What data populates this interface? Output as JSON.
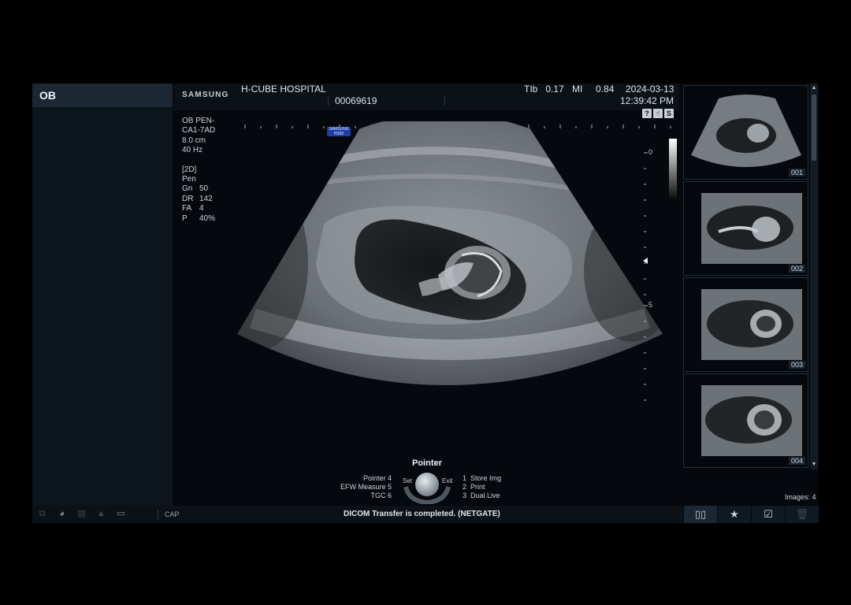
{
  "mode": {
    "title": "OB"
  },
  "header": {
    "brand": "SAMSUNG",
    "hospital": "H-CUBE HOSPITAL",
    "patient_id": "00069619",
    "tib_label": "TIb",
    "tib_value": "0.17",
    "mi_label": "MI",
    "mi_value": "0.84",
    "date": "2024-03-13",
    "time": "12:39:42 PM"
  },
  "status_icons": [
    "?",
    "☝",
    "S"
  ],
  "params": {
    "preset": "OB PEN-",
    "probe": "CA1-7AD",
    "depth": "8.0 cm",
    "frame_rate": "40 Hz",
    "mode": "[2D]",
    "pen": "Pen",
    "rows": [
      {
        "label": "Gn",
        "value": "50"
      },
      {
        "label": "DR",
        "value": "142"
      },
      {
        "label": "FA",
        "value": "4"
      },
      {
        "label": "P",
        "value": "40%"
      }
    ]
  },
  "probe_badge": {
    "line1": "SAMSUNG",
    "line2": "HS50"
  },
  "depth_scale": {
    "labels": [
      "0",
      "5"
    ]
  },
  "thumbnails": [
    {
      "id": "001"
    },
    {
      "id": "002"
    },
    {
      "id": "003"
    },
    {
      "id": "004"
    }
  ],
  "pointer_menu": {
    "title": "Pointer",
    "left": [
      {
        "label": "Pointer",
        "key": "4"
      },
      {
        "label": "EFW Measure",
        "key": "5"
      },
      {
        "label": "TGC",
        "key": "6"
      }
    ],
    "set_label": "Set",
    "exit_label": "Exit",
    "right": [
      {
        "key": "1",
        "label": "Store Img"
      },
      {
        "key": "2",
        "label": "Print"
      },
      {
        "key": "3",
        "label": "Dual Live"
      }
    ]
  },
  "images_count": "Images: 4",
  "statusbar": {
    "icons": [
      "copy-icon",
      "pie-icon",
      "report-icon",
      "alert-icon",
      "screen-icon"
    ],
    "cap": "CAP",
    "message": "DICOM Transfer is completed. (NETGATE)"
  },
  "bottom_buttons": [
    "dual-view-icon",
    "star-icon",
    "checkbox-icon",
    "trash-icon"
  ]
}
